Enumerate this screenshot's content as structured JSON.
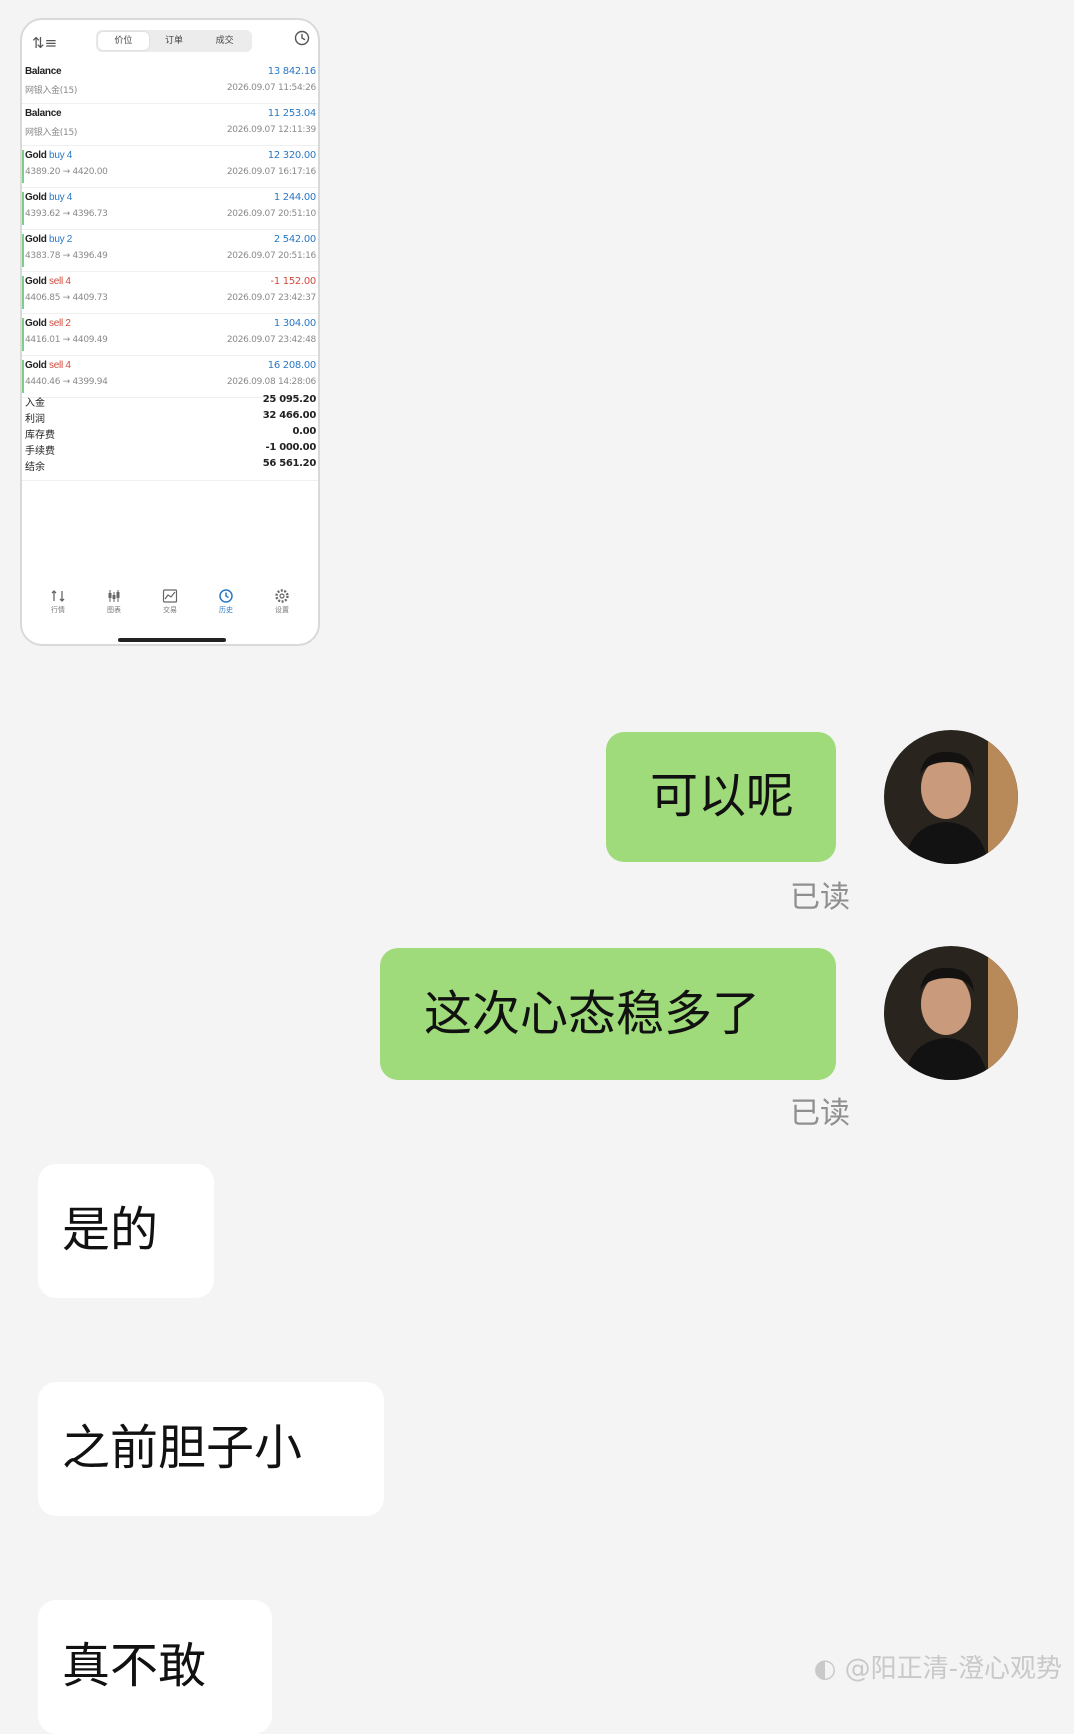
{
  "app": {
    "tabs": [
      "价位",
      "订单",
      "成交"
    ],
    "active_tab": 0,
    "history": [
      {
        "symbol": "Balance",
        "dir": "",
        "lots": "",
        "sub": "网银入金(15)",
        "profit": "13 842.16",
        "time": "2026.09.07 11:54:26",
        "neg": false,
        "trade": false
      },
      {
        "symbol": "Balance",
        "dir": "",
        "lots": "",
        "sub": "网银入金(15)",
        "profit": "11 253.04",
        "time": "2026.09.07 12:11:39",
        "neg": false,
        "trade": false
      },
      {
        "symbol": "Gold",
        "dir": "buy",
        "lots": "4",
        "sub": "4389.20 → 4420.00",
        "profit": "12 320.00",
        "time": "2026.09.07 16:17:16",
        "neg": false,
        "trade": true
      },
      {
        "symbol": "Gold",
        "dir": "buy",
        "lots": "4",
        "sub": "4393.62 → 4396.73",
        "profit": "1 244.00",
        "time": "2026.09.07 20:51:10",
        "neg": false,
        "trade": true
      },
      {
        "symbol": "Gold",
        "dir": "buy",
        "lots": "2",
        "sub": "4383.78 → 4396.49",
        "profit": "2 542.00",
        "time": "2026.09.07 20:51:16",
        "neg": false,
        "trade": true
      },
      {
        "symbol": "Gold",
        "dir": "sell",
        "lots": "4",
        "sub": "4406.85 → 4409.73",
        "profit": "-1 152.00",
        "time": "2026.09.07 23:42:37",
        "neg": true,
        "trade": true
      },
      {
        "symbol": "Gold",
        "dir": "sell",
        "lots": "2",
        "sub": "4416.01 → 4409.49",
        "profit": "1 304.00",
        "time": "2026.09.07 23:42:48",
        "neg": false,
        "trade": true
      },
      {
        "symbol": "Gold",
        "dir": "sell",
        "lots": "4",
        "sub": "4440.46 → 4399.94",
        "profit": "16 208.00",
        "time": "2026.09.08 14:28:06",
        "neg": false,
        "trade": true
      }
    ],
    "summary": [
      {
        "label": "入金",
        "value": "25 095.20"
      },
      {
        "label": "利润",
        "value": "32 466.00"
      },
      {
        "label": "库存费",
        "value": "0.00"
      },
      {
        "label": "手续费",
        "value": "-1 000.00"
      },
      {
        "label": "结余",
        "value": "56 561.20"
      }
    ],
    "nav": [
      {
        "label": "行情",
        "icon": "quotes-icon"
      },
      {
        "label": "图表",
        "icon": "chart-icon"
      },
      {
        "label": "交易",
        "icon": "trade-icon"
      },
      {
        "label": "历史",
        "icon": "history-icon"
      },
      {
        "label": "设置",
        "icon": "settings-icon"
      }
    ],
    "active_nav": 3,
    "colors": {
      "buy": "#2a78c6",
      "sell": "#d24a3c"
    }
  },
  "chat": {
    "msg1": "可以呢",
    "msg1_status": "已读",
    "msg2": "这次心态稳多了",
    "msg2_status": "已读",
    "msg3": "是的",
    "msg4": "之前胆子小",
    "msg5": "真不敢",
    "bubble_color_self": "#9fdb7a",
    "bubble_color_other": "#ffffff"
  },
  "watermark": "@阳正清-澄心观势"
}
